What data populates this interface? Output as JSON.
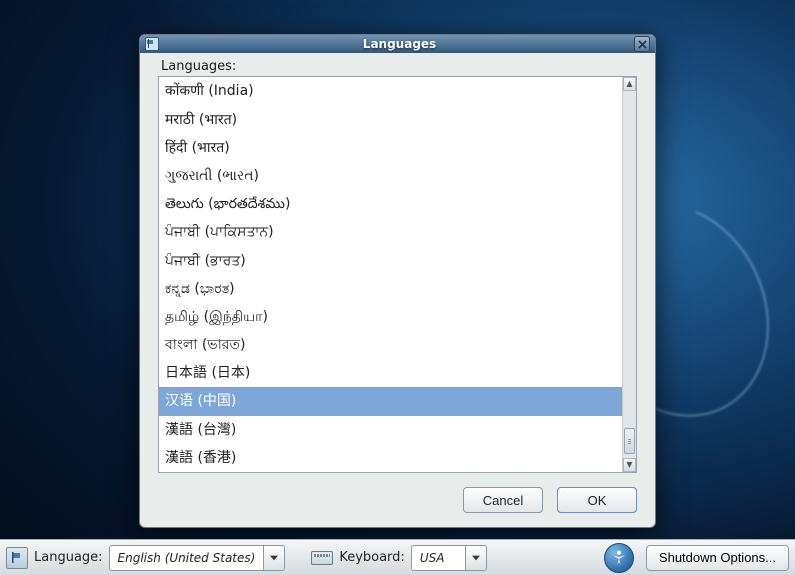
{
  "dialog": {
    "title": "Languages",
    "list_label": "Languages:",
    "items": [
      {
        "label": "कोंकणी (India)"
      },
      {
        "label": "मराठी (भारत)"
      },
      {
        "label": "हिंदी (भारत)"
      },
      {
        "label": "ગુજરાતી (ભારત)"
      },
      {
        "label": "తెలుగు (భారతదేశము)"
      },
      {
        "label": "ਪੰਜਾਬੀ (ਪਾਕਿਸਤਾਨ)"
      },
      {
        "label": "ਪੰਜਾਬੀ (ਭਾਰਤ)"
      },
      {
        "label": "ಕನ್ನಡ (ಭಾರತ)"
      },
      {
        "label": "தமிழ் (இந்தியா)"
      },
      {
        "label": "বাংলা (ভারত)"
      },
      {
        "label": "日本語 (日本)"
      },
      {
        "label": "汉语 (中国)",
        "selected": true
      },
      {
        "label": "漢語 (台灣)"
      },
      {
        "label": "漢語 (香港)"
      }
    ],
    "cancel_label": "Cancel",
    "ok_label": "OK"
  },
  "panel": {
    "language_label": "Language:",
    "language_value": "English (United States)",
    "keyboard_label": "Keyboard:",
    "keyboard_value": "USA",
    "shutdown_label": "Shutdown Options..."
  }
}
